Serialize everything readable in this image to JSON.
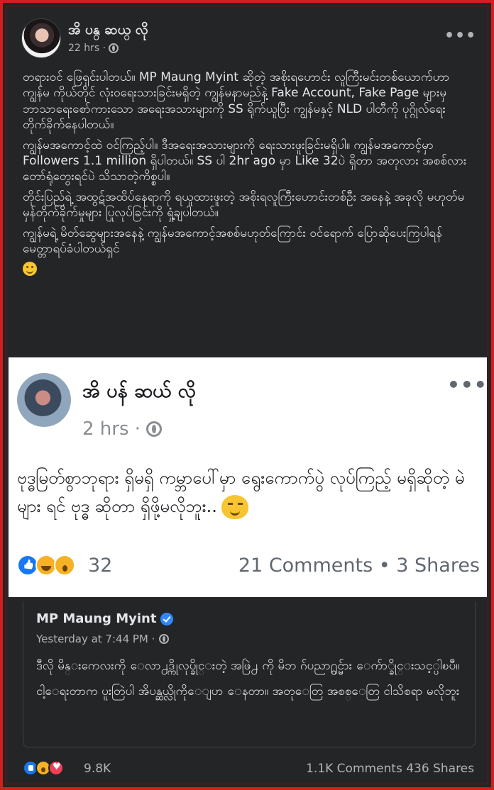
{
  "post": {
    "author": "အိ ပန္ ဆယ္ လို",
    "time": "22 hrs ·",
    "more": "•••",
    "paragraphs": [
      "တရားဝင် ဖြေရှင်းပါတယ်။ MP Maung Myint ဆိုတဲ့ အစိုးရဟောင်း လူကြီးမင်းတစ်ယောက်ဟာ ကျွန်မ ကိုယ်တိုင် လုံးဝရေးသားခြင်းမရှိတဲ့ ကျွန်မနာမည်နဲ့ Fake Account, Fake Page များမှ ဘာသာရေးစော်ကားသော အရေးအသားများကို SS ရိုက်ယူပြီး ကျွန်မနှင့် NLD ပါတီကို ပုဂ္ဂိုလ်ရေး တိုက်ခိုက်နေပါတယ်။",
      "ကျွန်မအကောင့်ထဲ ဝင်ကြည့်ပါ။ ဒီအရေးအသားများကို ရေးသားဖူးခြင်းမရှိပါ။ ကျွန်မအကောင့်မှာ Followers 1.1 million ရှိပါတယ်။ SS ပါ 2hr ago မှာ Like 32ပဲ ရှိတာ အတုလား အစစ်လား တော်ရုံတွေးရင်ပဲ သိသာတဲ့ကိစ္စပါ။",
      "တိုင်းပြည်ရဲ့ အထွဋ်အထိပ်နေရာကို ရယူထားဖူးတဲ့ အစိုးရလူကြီးဟောင်းတစ်ဦး အနေနဲ့ အခုလို မဟုတ်မမှန်တိုက်ခိုက်မှုများ ပြုလုပ်ခြင်းကို ရှုံ့ချပါတယ်။",
      "ကျွန်မရဲ့ မိတ်ဆွေများအနေနဲ့ ကျွန်မအကောင့်အစစ်မဟုတ်ကြောင်း ဝင်ရောက် ပြောဆိုပေးကြပါရန် မေတ္တာရပ်ခံပါတယ်ရှင်"
    ]
  },
  "embed": {
    "author": "အိ ပန် ဆယ် လို",
    "time": "2 hrs ·",
    "more": "•••",
    "text": "ဗုဒ္ဓမြတ်စွာဘုရား ရှိမရှိ ကမ္ဘာပေါ်မှာ ရွေးကောက်ပွဲ လုပ်ကြည့် မရှိဆိုတဲ့ မဲ များ ရင် ဗုဒ္ဓ ဆိုတာ ရှိဖို့မလိုဘူး..",
    "reactions_count": "32",
    "stats": "21 Comments • 3 Shares"
  },
  "quote": {
    "name": "MP Maung Myint",
    "time": "Yesterday at 7:44 PM ·",
    "paragraphs": [
      "ဒီလို မိန္းကေလးကို ေလာ႕ဒ္ကိုလုပ္ခိုင္းတဲ့ အဖြဲ႕ ကို မိဘ ဂ်ပညာ႐ွင္မ်ား ေက်ာ္ခိုင္းသင့္ပါၿပီ။",
      "ငါ့ေရးတာက ပူးတြဲပါ အိပန္ဆယ္လိုကိုေျပာ ေနတာ။ အတု​ေတြ အစစ္​ေတြ ငါသိစရာ မလိုဘူး"
    ]
  },
  "bottom": {
    "reactions_count": "9.8K",
    "stats": "1.1K Comments  436 Shares"
  },
  "colors": {
    "frame_border": "#d11f1f",
    "dark_bg": "#242526",
    "like_blue": "#1877f2",
    "love_red": "#f33e58",
    "emoji_yellow": "#f7b125"
  }
}
